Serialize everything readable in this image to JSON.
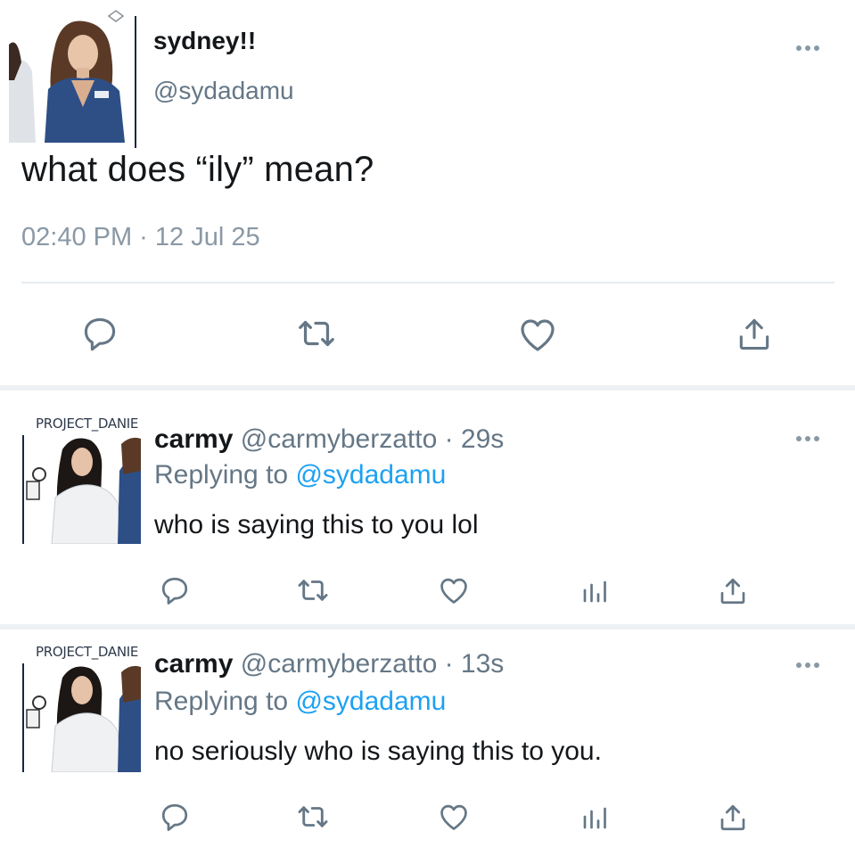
{
  "main_tweet": {
    "display_name": "sydney!!",
    "handle": "@sydadamu",
    "text": "what does “ily” mean?",
    "timestamp": "02:40 PM · 12 Jul 25",
    "actions": [
      "reply-icon",
      "retweet-icon",
      "like-icon",
      "share-icon"
    ]
  },
  "replies": [
    {
      "avatar_watermark": "PROJECT_DANIE",
      "display_name": "carmy",
      "handle_time": "@carmyberzatto · 29s",
      "replying_prefix": "Replying to ",
      "replying_to": "@sydadamu",
      "text": "who is saying this to you lol",
      "actions": [
        "reply-icon",
        "retweet-icon",
        "like-icon",
        "analytics-icon",
        "share-icon"
      ]
    },
    {
      "avatar_watermark": "PROJECT_DANIE",
      "display_name": "carmy",
      "handle_time": "@carmyberzatto · 13s",
      "replying_prefix": "Replying to ",
      "replying_to": "@sydadamu",
      "text": "no seriously who is saying this to you.",
      "actions": [
        "reply-icon",
        "retweet-icon",
        "like-icon",
        "analytics-icon",
        "share-icon"
      ]
    }
  ],
  "colors": {
    "text": "#14171a",
    "secondary": "#657786",
    "mention": "#1da1f2",
    "icon": "#657786",
    "divider": "#e6ecf0"
  }
}
